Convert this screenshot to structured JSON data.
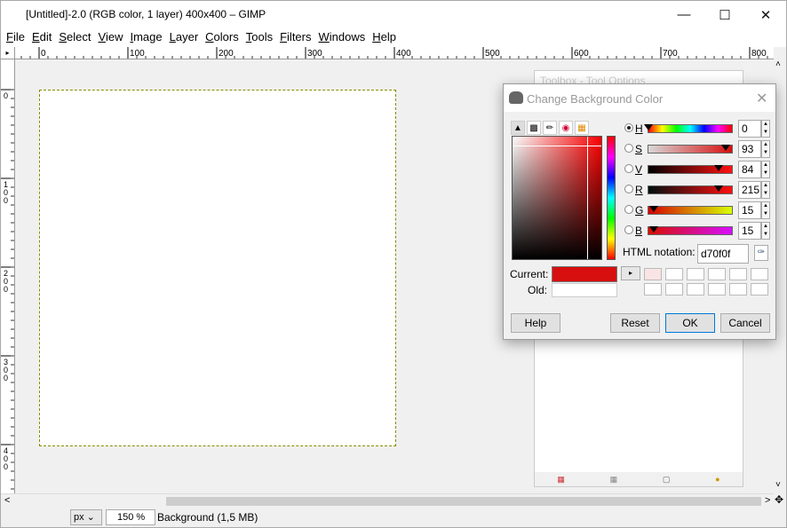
{
  "window": {
    "title": "[Untitled]-2.0 (RGB color, 1 layer) 400x400 – GIMP",
    "min_icon": "minimize-icon",
    "max_icon": "maximize-icon",
    "close_icon": "close-icon"
  },
  "menu": [
    "File",
    "Edit",
    "Select",
    "View",
    "Image",
    "Layer",
    "Colors",
    "Tools",
    "Filters",
    "Windows",
    "Help"
  ],
  "ruler": {
    "h_ticks": [
      "0",
      "100",
      "200",
      "300",
      "400",
      "500",
      "600",
      "700",
      "800"
    ],
    "v_ticks": [
      "0",
      "100",
      "200",
      "300",
      "400"
    ]
  },
  "status": {
    "unit": "px",
    "zoom": "150 %",
    "text": "Background (1,5 MB)"
  },
  "toolbox": {
    "title": "Toolbox - Tool Options"
  },
  "dialog": {
    "title": "Change Background Color",
    "sliders": [
      {
        "label": "H",
        "value": "0",
        "selected": true,
        "marker_frac": 0.0
      },
      {
        "label": "S",
        "value": "93",
        "selected": false,
        "marker_frac": 0.93
      },
      {
        "label": "V",
        "value": "84",
        "selected": false,
        "marker_frac": 0.84
      },
      {
        "label": "R",
        "value": "215",
        "selected": false,
        "marker_frac": 0.84
      },
      {
        "label": "G",
        "value": "15",
        "selected": false,
        "marker_frac": 0.06
      },
      {
        "label": "B",
        "value": "15",
        "selected": false,
        "marker_frac": 0.06
      }
    ],
    "html_label": "HTML notation:",
    "html_value": "d70f0f",
    "current_label": "Current:",
    "old_label": "Old:",
    "current_color": "#d70f0f",
    "old_color": "#ffffff",
    "buttons": {
      "help": "Help",
      "reset": "Reset",
      "ok": "OK",
      "cancel": "Cancel"
    }
  }
}
